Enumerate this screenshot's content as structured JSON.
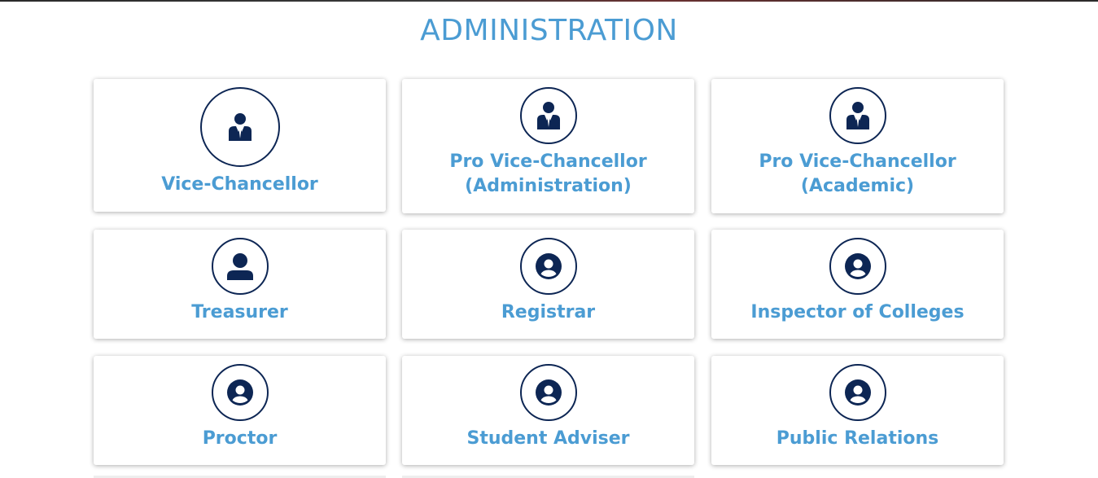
{
  "page": {
    "title": "ADMINISTRATION"
  },
  "cards": [
    {
      "line1": "Vice-Chancellor",
      "line2": "",
      "icon": "person-suit-icon"
    },
    {
      "line1": "Pro Vice-Chancellor",
      "line2": "(Administration)",
      "icon": "person-suit-icon"
    },
    {
      "line1": "Pro Vice-Chancellor",
      "line2": "(Academic)",
      "icon": "person-suit-icon"
    },
    {
      "line1": "Treasurer",
      "line2": "",
      "icon": "user-icon"
    },
    {
      "line1": "Registrar",
      "line2": "",
      "icon": "user-circle-icon"
    },
    {
      "line1": "Inspector of Colleges",
      "line2": "",
      "icon": "user-circle-icon"
    },
    {
      "line1": "Proctor",
      "line2": "",
      "icon": "user-circle-icon"
    },
    {
      "line1": "Student Adviser",
      "line2": "",
      "icon": "user-circle-icon"
    },
    {
      "line1": "Public Relations",
      "line2": "",
      "icon": "user-circle-icon"
    }
  ],
  "colors": {
    "accent": "#4b9cd3",
    "icon": "#0d2654"
  }
}
